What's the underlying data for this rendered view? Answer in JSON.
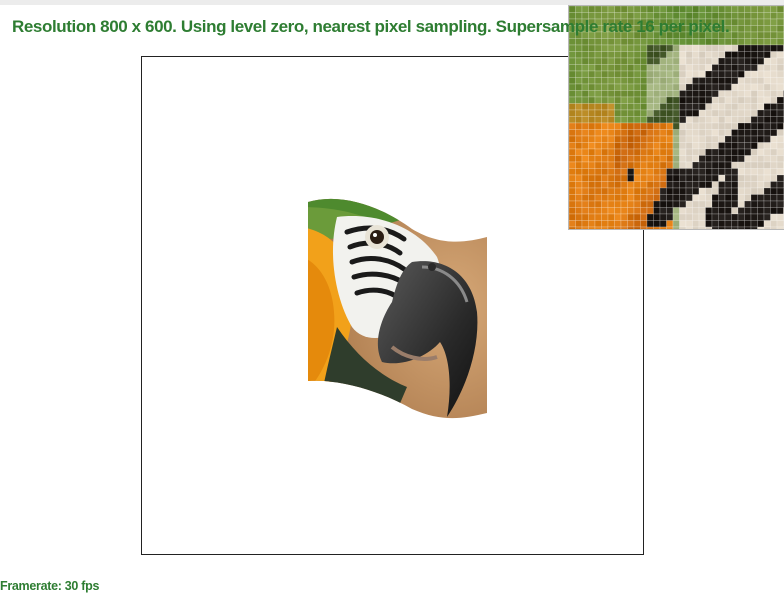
{
  "status": {
    "heading": "Resolution 800 x 600. Using level zero, nearest pixel sampling. Supersample rate 16 per pixel.",
    "framerate": "Framerate: 30 fps"
  },
  "colors": {
    "text": "#2e7d32",
    "viewport_border": "#222222"
  },
  "render": {
    "subject": "macaw-parrot-texture",
    "mapping": "wavy-flag-warp"
  },
  "zoom": {
    "description": "pixel-magnifier"
  }
}
